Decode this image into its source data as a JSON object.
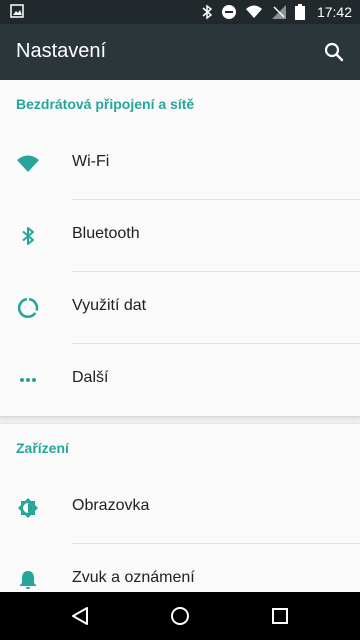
{
  "status_bar": {
    "time": "17:42"
  },
  "app_bar": {
    "title": "Nastavení"
  },
  "sections": [
    {
      "title": "Bezdrátová připojení a sítě",
      "items": [
        {
          "label": "Wi-Fi",
          "icon": "wifi-icon"
        },
        {
          "label": "Bluetooth",
          "icon": "bluetooth-icon"
        },
        {
          "label": "Využití dat",
          "icon": "data-usage-icon"
        },
        {
          "label": "Další",
          "icon": "more-icon"
        }
      ]
    },
    {
      "title": "Zařízení",
      "items": [
        {
          "label": "Obrazovka",
          "icon": "display-brightness-icon"
        },
        {
          "label": "Zvuk a oznámení",
          "icon": "notification-bell-icon"
        }
      ]
    }
  ],
  "colors": {
    "accent": "#26a69a",
    "app_bar": "#2b363a",
    "status_bar": "#22292c"
  }
}
